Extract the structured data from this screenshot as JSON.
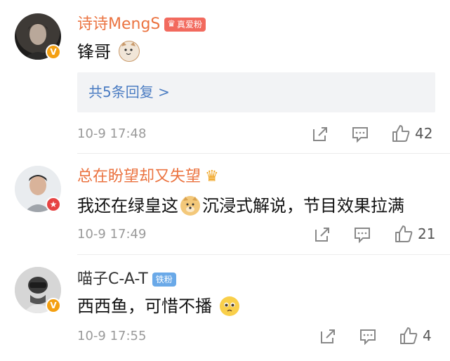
{
  "comments": [
    {
      "name": "诗诗MengS",
      "badge_text": "真爱粉",
      "text": "锋哥",
      "replies_label": "共5条回复 >",
      "time": "10-9 17:48",
      "likes": "42"
    },
    {
      "name": "总在盼望却又失望",
      "text_part1": "我还在绿皇这",
      "text_part2": "沉浸式解说，节目效果拉满",
      "time": "10-9 17:49",
      "likes": "21"
    },
    {
      "name": "喵子C-A-T",
      "badge_text": "铁粉",
      "text": "西西鱼，可惜不播",
      "time": "10-9 17:55",
      "likes": "4"
    }
  ],
  "icons": {
    "share": "share-icon",
    "comment": "comment-icon",
    "like": "thumbs-up-icon",
    "verified": "verified-badge-icon",
    "crown": "crown-icon"
  },
  "colors": {
    "name_vip": "#eb7340",
    "reply_link": "#4b7cc2",
    "meta": "#9a9a9a",
    "fan_tag": "#f26a5e",
    "iron_tag": "#6aa9e8"
  }
}
